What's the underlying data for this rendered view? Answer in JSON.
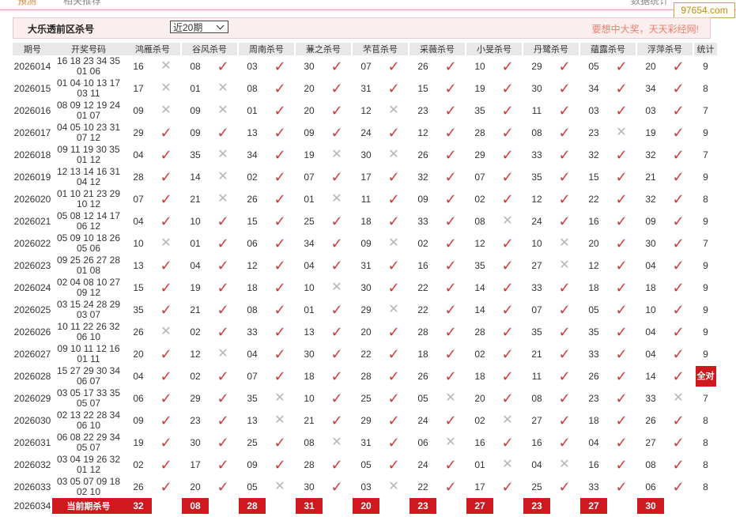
{
  "top": {
    "left_text": "预测",
    "mid_text": "相关推荐",
    "right_text": "数据统计"
  },
  "watermark": "97654.com",
  "header": {
    "title": "大乐透前区杀号",
    "select_value": "近20期",
    "slogan": "要想中大奖，天天彩经网!"
  },
  "columns": {
    "period": "期号",
    "draw": "开奖号码",
    "count": "统计",
    "experts": [
      "鸿雁杀号",
      "谷风杀号",
      "周南杀号",
      "蒹之杀号",
      "芣苢杀号",
      "采薇杀号",
      "小旻杀号",
      "丹鹭杀号",
      "蘊露杀号",
      "浮萍杀号"
    ]
  },
  "rows": [
    {
      "period": "2026014",
      "draw1": "16 18 23 34 35",
      "draw2": "01 06",
      "kills": [
        "16",
        "08",
        "03",
        "30",
        "07",
        "26",
        "10",
        "29",
        "05",
        "20"
      ],
      "ok": [
        0,
        1,
        1,
        1,
        1,
        1,
        1,
        1,
        1,
        1
      ],
      "count": "9"
    },
    {
      "period": "2026015",
      "draw1": "01 04 10 13 17",
      "draw2": "03 11",
      "kills": [
        "17",
        "01",
        "08",
        "20",
        "31",
        "15",
        "19",
        "30",
        "34",
        "34"
      ],
      "ok": [
        0,
        0,
        1,
        1,
        1,
        1,
        1,
        1,
        1,
        1
      ],
      "count": "8"
    },
    {
      "period": "2026016",
      "draw1": "08 09 12 19 24",
      "draw2": "01 07",
      "kills": [
        "09",
        "09",
        "01",
        "20",
        "12",
        "23",
        "35",
        "11",
        "03",
        "03"
      ],
      "ok": [
        0,
        0,
        1,
        1,
        0,
        1,
        1,
        1,
        1,
        1
      ],
      "count": "7"
    },
    {
      "period": "2026017",
      "draw1": "04 05 10 23 31",
      "draw2": "07 12",
      "kills": [
        "29",
        "09",
        "13",
        "09",
        "24",
        "12",
        "28",
        "08",
        "23",
        "19"
      ],
      "ok": [
        1,
        1,
        1,
        1,
        1,
        1,
        1,
        1,
        0,
        1
      ],
      "count": "9"
    },
    {
      "period": "2026018",
      "draw1": "09 11 19 30 35",
      "draw2": "01 12",
      "kills": [
        "04",
        "35",
        "34",
        "19",
        "30",
        "26",
        "29",
        "33",
        "32",
        "32"
      ],
      "ok": [
        1,
        0,
        1,
        0,
        0,
        1,
        1,
        1,
        1,
        1
      ],
      "count": "7"
    },
    {
      "period": "2026019",
      "draw1": "12 13 14 16 31",
      "draw2": "04 12",
      "kills": [
        "28",
        "14",
        "02",
        "07",
        "17",
        "32",
        "07",
        "35",
        "15",
        "21"
      ],
      "ok": [
        1,
        0,
        1,
        1,
        1,
        1,
        1,
        1,
        1,
        1
      ],
      "count": "9"
    },
    {
      "period": "2026020",
      "draw1": "01 10 21 23 29",
      "draw2": "10 12",
      "kills": [
        "07",
        "21",
        "26",
        "01",
        "11",
        "09",
        "02",
        "12",
        "22",
        "32"
      ],
      "ok": [
        1,
        0,
        1,
        0,
        1,
        1,
        1,
        1,
        1,
        1
      ],
      "count": "8"
    },
    {
      "period": "2026021",
      "draw1": "05 08 12 14 17",
      "draw2": "06 12",
      "kills": [
        "04",
        "10",
        "15",
        "25",
        "18",
        "33",
        "08",
        "24",
        "16",
        "09"
      ],
      "ok": [
        1,
        1,
        1,
        1,
        1,
        1,
        0,
        1,
        1,
        1
      ],
      "count": "9"
    },
    {
      "period": "2026022",
      "draw1": "05 09 10 18 26",
      "draw2": "05 06",
      "kills": [
        "10",
        "01",
        "06",
        "34",
        "09",
        "02",
        "12",
        "10",
        "20",
        "30"
      ],
      "ok": [
        0,
        1,
        1,
        1,
        0,
        1,
        1,
        0,
        1,
        1
      ],
      "count": "7"
    },
    {
      "period": "2026023",
      "draw1": "09 25 26 27 28",
      "draw2": "01 08",
      "kills": [
        "13",
        "04",
        "12",
        "04",
        "31",
        "16",
        "35",
        "27",
        "12",
        "04"
      ],
      "ok": [
        1,
        1,
        1,
        1,
        1,
        1,
        1,
        0,
        1,
        1
      ],
      "count": "9"
    },
    {
      "period": "2026024",
      "draw1": "02 04 08 10 27",
      "draw2": "09 12",
      "kills": [
        "15",
        "19",
        "18",
        "10",
        "30",
        "22",
        "14",
        "33",
        "18",
        "18"
      ],
      "ok": [
        1,
        1,
        1,
        0,
        1,
        1,
        1,
        1,
        1,
        1
      ],
      "count": "9"
    },
    {
      "period": "2026025",
      "draw1": "03 15 24 28 29",
      "draw2": "03 07",
      "kills": [
        "35",
        "21",
        "08",
        "01",
        "29",
        "22",
        "14",
        "07",
        "05",
        "10"
      ],
      "ok": [
        1,
        1,
        1,
        1,
        0,
        1,
        1,
        1,
        1,
        1
      ],
      "count": "9"
    },
    {
      "period": "2026026",
      "draw1": "10 11 22 26 32",
      "draw2": "06 10",
      "kills": [
        "26",
        "02",
        "33",
        "13",
        "20",
        "28",
        "28",
        "35",
        "35",
        "04"
      ],
      "ok": [
        0,
        1,
        1,
        1,
        1,
        1,
        1,
        1,
        1,
        1
      ],
      "count": "9"
    },
    {
      "period": "2026027",
      "draw1": "09 10 11 12 16",
      "draw2": "01 11",
      "kills": [
        "20",
        "12",
        "04",
        "30",
        "22",
        "18",
        "02",
        "21",
        "33",
        "04"
      ],
      "ok": [
        1,
        0,
        1,
        1,
        1,
        1,
        1,
        1,
        1,
        1
      ],
      "count": "9"
    },
    {
      "period": "2026028",
      "draw1": "15 27 29 30 34",
      "draw2": "06 07",
      "kills": [
        "04",
        "02",
        "07",
        "18",
        "28",
        "26",
        "18",
        "11",
        "26",
        "14"
      ],
      "ok": [
        1,
        1,
        1,
        1,
        1,
        1,
        1,
        1,
        1,
        1
      ],
      "count": "全对"
    },
    {
      "period": "2026029",
      "draw1": "03 05 17 33 35",
      "draw2": "05 07",
      "kills": [
        "06",
        "29",
        "35",
        "10",
        "25",
        "05",
        "20",
        "08",
        "23",
        "33"
      ],
      "ok": [
        1,
        1,
        0,
        1,
        1,
        0,
        1,
        1,
        1,
        0
      ],
      "count": "7"
    },
    {
      "period": "2026030",
      "draw1": "02 13 22 28 34",
      "draw2": "06 10",
      "kills": [
        "09",
        "23",
        "13",
        "21",
        "29",
        "24",
        "02",
        "27",
        "18",
        "26"
      ],
      "ok": [
        1,
        1,
        0,
        1,
        1,
        1,
        0,
        1,
        1,
        1
      ],
      "count": "8"
    },
    {
      "period": "2026031",
      "draw1": "06 08 22 29 34",
      "draw2": "05 07",
      "kills": [
        "19",
        "30",
        "25",
        "08",
        "31",
        "06",
        "16",
        "16",
        "04",
        "27"
      ],
      "ok": [
        1,
        1,
        1,
        0,
        1,
        0,
        1,
        1,
        1,
        1
      ],
      "count": "8"
    },
    {
      "period": "2026032",
      "draw1": "03 04 19 26 32",
      "draw2": "01 12",
      "kills": [
        "02",
        "17",
        "09",
        "28",
        "05",
        "24",
        "01",
        "04",
        "16",
        "08"
      ],
      "ok": [
        1,
        1,
        1,
        1,
        1,
        1,
        0,
        0,
        1,
        1
      ],
      "count": "8"
    },
    {
      "period": "2026033",
      "draw1": "03 05 07 09 18",
      "draw2": "02 10",
      "kills": [
        "26",
        "20",
        "05",
        "30",
        "03",
        "22",
        "17",
        "25",
        "33",
        "06"
      ],
      "ok": [
        1,
        1,
        0,
        1,
        0,
        1,
        1,
        1,
        1,
        1
      ],
      "count": "8"
    }
  ],
  "current": {
    "period": "2026034",
    "label": "当前期杀号",
    "kills": [
      "32",
      "08",
      "28",
      "31",
      "20",
      "23",
      "27",
      "23",
      "27",
      "30"
    ]
  },
  "symbols": {
    "ok": "✓",
    "no": "✕"
  },
  "colors": {
    "accent": "#d0191f",
    "miss": "#b5b5b5",
    "header_bg": "#fbeeee"
  }
}
